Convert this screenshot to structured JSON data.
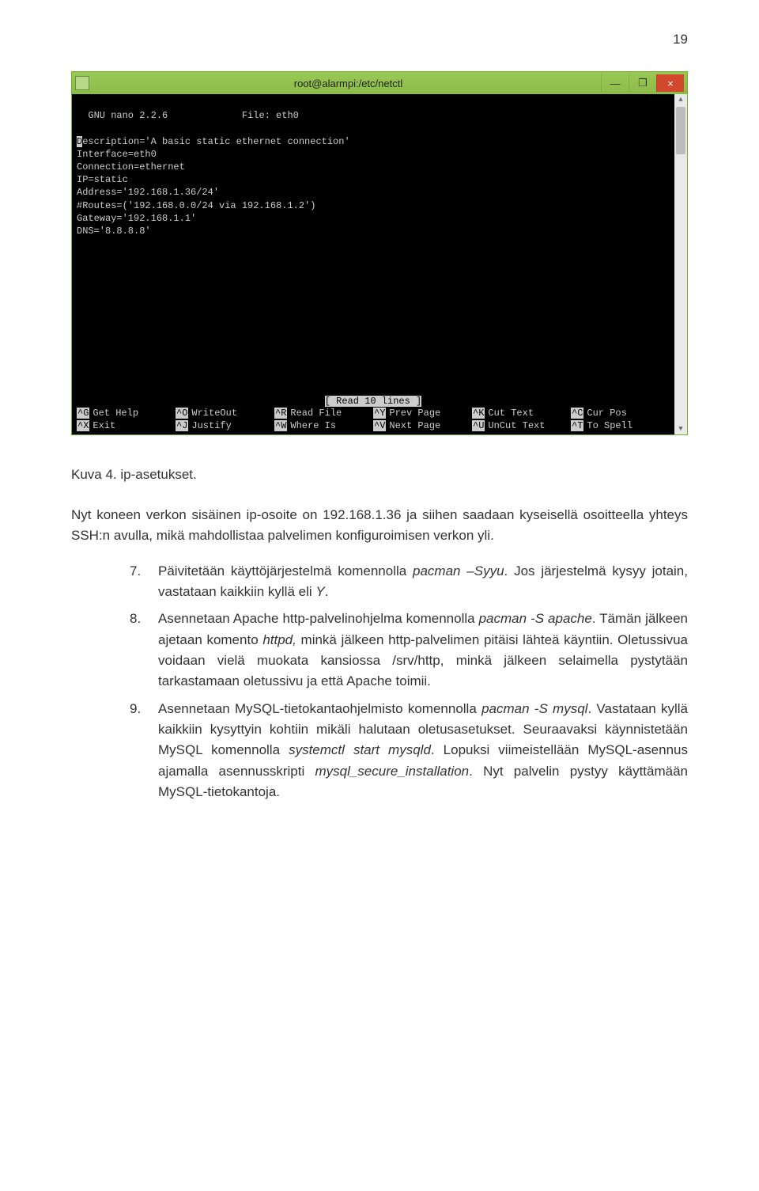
{
  "page_number": "19",
  "window": {
    "title": "root@alarmpi:/etc/netctl",
    "minimize": "—",
    "maximize": "❐",
    "close": "×"
  },
  "nano": {
    "app": "  GNU nano 2.2.6",
    "file_label": "File: eth0",
    "lines": [
      "Description='A basic static ethernet connection'",
      "Interface=eth0",
      "Connection=ethernet",
      "IP=static",
      "Address='192.168.1.36/24'",
      "#Routes=('192.168.0.0/24 via 192.168.1.2')",
      "Gateway='192.168.1.1'",
      "DNS='8.8.8.8'"
    ],
    "status": "[ Read 10 lines ]",
    "shortcuts": [
      [
        {
          "key": "^G",
          "label": "Get Help"
        },
        {
          "key": "^O",
          "label": "WriteOut"
        },
        {
          "key": "^R",
          "label": "Read File"
        },
        {
          "key": "^Y",
          "label": "Prev Page"
        },
        {
          "key": "^K",
          "label": "Cut Text"
        },
        {
          "key": "^C",
          "label": "Cur Pos"
        }
      ],
      [
        {
          "key": "^X",
          "label": "Exit"
        },
        {
          "key": "^J",
          "label": "Justify"
        },
        {
          "key": "^W",
          "label": "Where Is"
        },
        {
          "key": "^V",
          "label": "Next Page"
        },
        {
          "key": "^U",
          "label": "UnCut Text"
        },
        {
          "key": "^T",
          "label": "To Spell"
        }
      ]
    ]
  },
  "caption": "Kuva 4. ip-asetukset.",
  "intro": "Nyt koneen verkon sisäinen ip-osoite on 192.168.1.36 ja siihen saadaan kyseisellä osoitteella yhteys SSH:n avulla, mikä mahdollistaa palvelimen konfiguroimisen verkon yli.",
  "items": [
    {
      "marker": "7.",
      "parts": [
        {
          "t": "Päivitetään käyttöjärjestelmä komennolla "
        },
        {
          "t": "pacman –Syyu",
          "italic": true
        },
        {
          "t": ". Jos järjestelmä kysyy jotain, vastataan kaikkiin kyllä eli "
        },
        {
          "t": "Y",
          "italic": true
        },
        {
          "t": "."
        }
      ]
    },
    {
      "marker": "8.",
      "parts": [
        {
          "t": "Asennetaan Apache http-palvelinohjelma komennolla "
        },
        {
          "t": "pacman -S apache",
          "italic": true
        },
        {
          "t": ". Tämän jälkeen ajetaan komento "
        },
        {
          "t": "httpd,",
          "italic": true
        },
        {
          "t": " minkä jälkeen http-palvelimen pitäisi lähteä käyntiin. Oletussivua voidaan vielä muokata kansiossa /srv/http, minkä jälkeen selaimella pystytään tarkastamaan oletussivu ja että Apache toimii."
        }
      ]
    },
    {
      "marker": "9.",
      "parts": [
        {
          "t": "Asennetaan MySQL-tietokantaohjelmisto komennolla "
        },
        {
          "t": "pacman -S mysql",
          "italic": true
        },
        {
          "t": ". Vastataan kyllä kaikkiin kysyttyin kohtiin mikäli halutaan oletusasetukset. Seuraavaksi käynnistetään MySQL komennolla "
        },
        {
          "t": "systemctl start mysqld",
          "italic": true
        },
        {
          "t": ". Lopuksi viimeistellään MySQL-asennus ajamalla asennusskripti "
        },
        {
          "t": "mysql_secure_installation",
          "italic": true
        },
        {
          "t": ". Nyt palvelin pystyy käyttämään MySQL-tietokantoja."
        }
      ]
    }
  ]
}
